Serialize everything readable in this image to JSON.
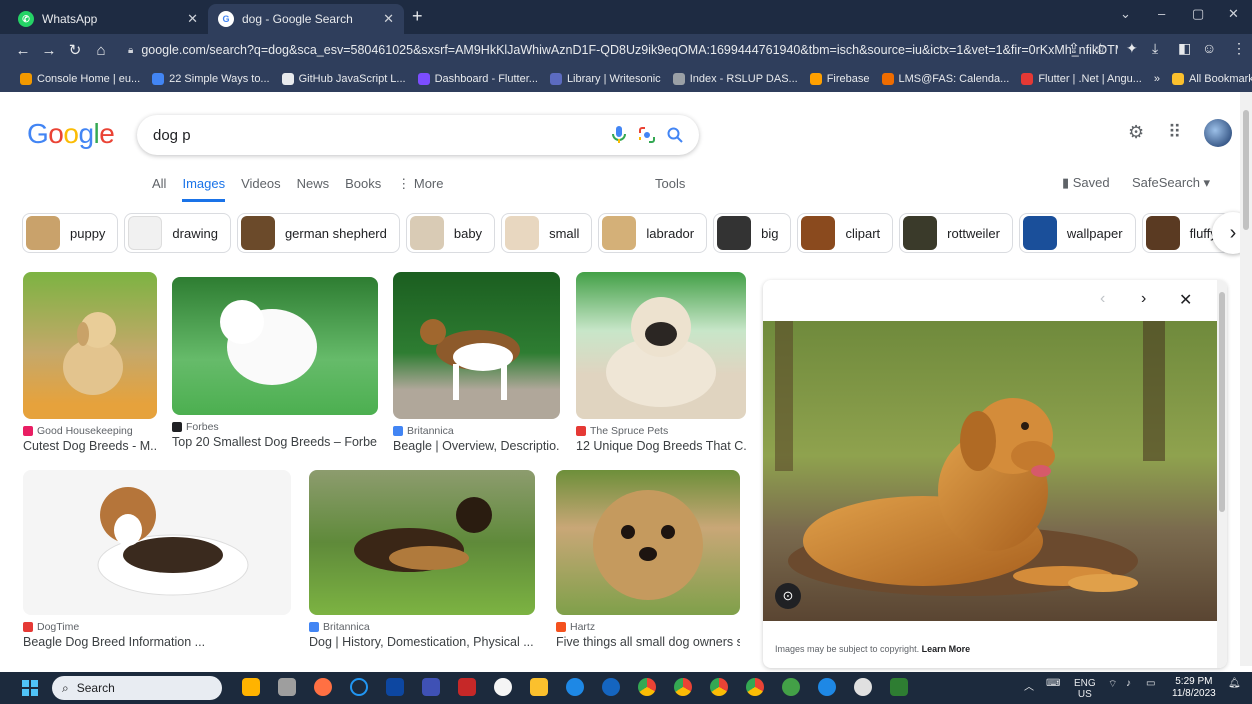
{
  "tabs": [
    {
      "title": "WhatsApp",
      "active": false
    },
    {
      "title": "dog - Google Search",
      "active": true
    }
  ],
  "new_tab_label": "+",
  "window_controls": [
    "⌄",
    "–",
    "▢",
    "✕"
  ],
  "url": "google.com/search?q=dog&sca_esv=580461025&sxsrf=AM9HkKlJaWhiwAznD1F-QD8Uz9ik9eqOMA:1699444761940&tbm=isch&source=iu&ictx=1&vet=1&fir=0rKxMh_nfikDTM...",
  "bookmarks": [
    {
      "label": "Console Home | eu...",
      "color": "#f29900"
    },
    {
      "label": "22 Simple Ways to...",
      "color": "#4285f4"
    },
    {
      "label": "GitHub JavaScript L...",
      "color": "#e8eaed"
    },
    {
      "label": "Dashboard - Flutter...",
      "color": "#7c4dff"
    },
    {
      "label": "Library | Writesonic",
      "color": "#5c6bc0"
    },
    {
      "label": "Index - RSLUP DAS...",
      "color": "#9aa0a6"
    },
    {
      "label": "Firebase",
      "color": "#ffa000"
    },
    {
      "label": "LMS@FAS: Calenda...",
      "color": "#ef6c00"
    },
    {
      "label": "Flutter | .Net | Angu...",
      "color": "#e53935"
    }
  ],
  "all_bookmarks_label": "All Bookmarks",
  "bookmarks_more": "»",
  "logo": [
    "G",
    "o",
    "o",
    "g",
    "l",
    "e"
  ],
  "logo_colors": [
    "#4285f4",
    "#ea4335",
    "#fbbc05",
    "#4285f4",
    "#34a853",
    "#ea4335"
  ],
  "search": {
    "query": "dog p"
  },
  "nav": {
    "tabs": [
      "All",
      "Images",
      "Videos",
      "News",
      "Books",
      "⋮ More"
    ],
    "active": 1,
    "tools": "Tools",
    "saved": "Saved",
    "safesearch": "SafeSearch ▾"
  },
  "chips": [
    {
      "label": "puppy",
      "color": "#c9a26b"
    },
    {
      "label": "drawing",
      "color": "#f1f1f1"
    },
    {
      "label": "german shepherd",
      "color": "#6b4a2a"
    },
    {
      "label": "baby",
      "color": "#d9cbb5"
    },
    {
      "label": "small",
      "color": "#e8d7c0"
    },
    {
      "label": "labrador",
      "color": "#d4b078"
    },
    {
      "label": "big",
      "color": "#333333"
    },
    {
      "label": "clipart",
      "color": "#8a4a1e"
    },
    {
      "label": "rottweiler",
      "color": "#3a3a2a"
    },
    {
      "label": "wallpaper",
      "color": "#1a4f9a"
    },
    {
      "label": "fluffy",
      "color": "#5a3a22"
    }
  ],
  "results": [
    {
      "source": "Good Housekeeping",
      "title": "Cutest Dog Breeds - M...",
      "src_color": "#e91e63",
      "bg": "linear-gradient(#7cb342,#c5a86a 55%,#e6a23c 90%)"
    },
    {
      "source": "Forbes",
      "title": "Top 20 Smallest Dog Breeds – Forbe...",
      "src_color": "#202124",
      "bg": "linear-gradient(#2e7d32,#66bb6a 60%,#4caf50)"
    },
    {
      "source": "Britannica",
      "title": "Beagle | Overview, Descriptio...",
      "src_color": "#4285f4",
      "bg": "linear-gradient(#1b5e20,#2e7d32 55%,#b0a79a 80%)"
    },
    {
      "source": "The Spruce Pets",
      "title": "12 Unique Dog Breeds That C...",
      "src_color": "#e53935",
      "bg": "linear-gradient(#43a047,#c8e6c9 40%,#e0d4c0 70%)"
    },
    {
      "source": "DogTime",
      "title": "Beagle Dog Breed Information ...",
      "src_color": "#e53935",
      "bg": "linear-gradient(#f5f5f5,#f5f5f5)"
    },
    {
      "source": "Britannica",
      "title": "Dog | History, Domestication, Physical ...",
      "src_color": "#4285f4",
      "bg": "linear-gradient(#8d9c6e,#5f8a3a 50%,#7cb342)"
    },
    {
      "source": "Hartz",
      "title": "Five things all small dog owners s...",
      "src_color": "#f4511e",
      "bg": "linear-gradient(#6d8f3a,#c9a777 40%,#7fa04a)"
    }
  ],
  "preview": {
    "copyright_note": "Images may be subject to copyright.",
    "learn_more": "Learn More"
  },
  "taskbar": {
    "search_placeholder": "Search",
    "apps": [
      "#ffb300",
      "#9e9e9e",
      "#ff7043",
      "#2196f3",
      "#0d47a1",
      "#3f51b5",
      "#c62828",
      "#212121",
      "#fbc02d",
      "#1e88e5",
      "#1565c0",
      "#ea4335",
      "#ea4335",
      "#34a853",
      "#4285f4",
      "#43a047",
      "#1e88e5",
      "#e0e0e0",
      "#2e7d32"
    ],
    "lang": "ENG",
    "region": "US",
    "time": "5:29 PM",
    "date": "11/8/2023"
  }
}
